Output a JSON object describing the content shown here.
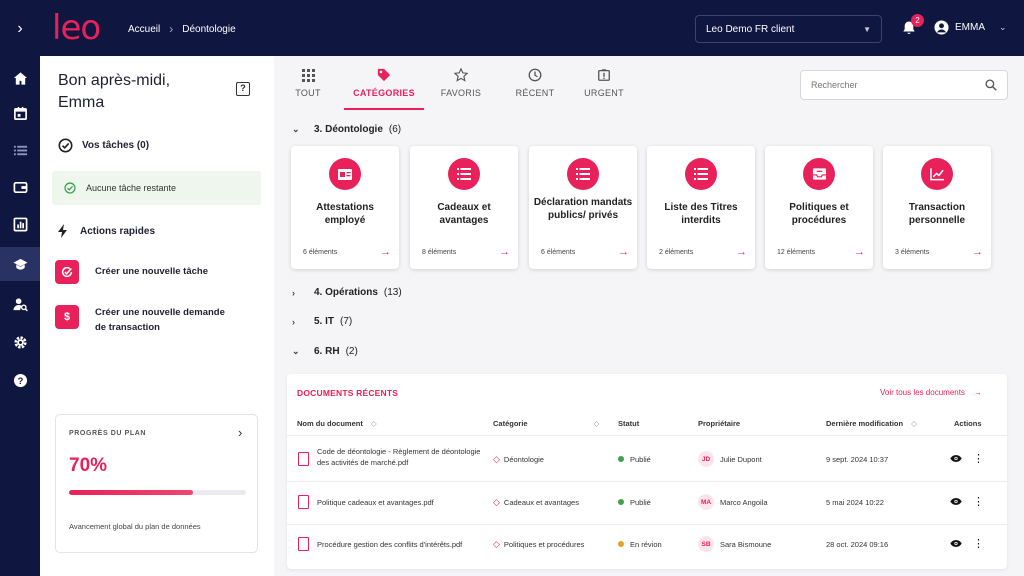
{
  "app": {
    "logo": "leo"
  },
  "breadcrumb": [
    "Accueil",
    "Déontologie"
  ],
  "header": {
    "client": "Leo Demo FR client",
    "notifications": "2",
    "user": "EMMA"
  },
  "colors": {
    "accent": "#e8215a",
    "navy": "#0f1640",
    "success": "#3fa34d",
    "warning": "#e8a21f"
  },
  "sidebar_icons": [
    "chevron-right-icon",
    "home-icon",
    "calendar-icon",
    "list-icon",
    "wallet-icon",
    "report-icon",
    "graduation-cap-icon",
    "user-search-icon",
    "gear-icon",
    "question-icon"
  ],
  "left": {
    "greeting": "Bon après-midi,",
    "name": "Emma",
    "tasks_title": "Vos tâches (0)",
    "no_tasks": "Aucune tâche restante",
    "quick_title": "Actions rapides",
    "actions": [
      "Créer une nouvelle tâche",
      "Créer une nouvelle demande de transaction"
    ],
    "plan": {
      "label": "PROGRÈS DU PLAN",
      "percent_text": "70%",
      "progress": 0.7,
      "desc": "Avancement global du plan de données"
    }
  },
  "tabs": [
    {
      "label": "TOUT",
      "icon": "grid-icon"
    },
    {
      "label": "CATÉGORIES",
      "icon": "tag-icon",
      "active": true
    },
    {
      "label": "FAVORIS",
      "icon": "star-icon"
    },
    {
      "label": "RÉCENT",
      "icon": "clock-icon"
    },
    {
      "label": "URGENT",
      "icon": "urgent-icon"
    }
  ],
  "search": {
    "placeholder": "Rechercher"
  },
  "categories": [
    {
      "label": "3. Déontologie",
      "count": "(6)",
      "expanded": true
    },
    {
      "label": "4. Opérations",
      "count": "(13)"
    },
    {
      "label": "5. IT",
      "count": "(7)"
    },
    {
      "label": "6. RH",
      "count": "(2)",
      "expanded": true
    }
  ],
  "cards": [
    {
      "title": "Attestations employé",
      "count": "6 éléments"
    },
    {
      "title": "Cadeaux et avantages",
      "count": "8 éléments"
    },
    {
      "title": "Déclaration mandats publics/ privés",
      "count": "6 éléments"
    },
    {
      "title": "Liste des Titres interdits",
      "count": "2 éléments"
    },
    {
      "title": "Politiques et procédures",
      "count": "12 éléments"
    },
    {
      "title": "Transaction personnelle",
      "count": "3 éléments"
    }
  ],
  "recent": {
    "title": "DOCUMENTS RÉCENTS",
    "view_all": "Voir tous les documents",
    "columns": [
      "Nom du document",
      "Catégorie",
      "Statut",
      "Propriétaire",
      "Dernière modification",
      "Actions"
    ],
    "rows": [
      {
        "name": "Code de déontologie - Règlement de déontologie des activités de marché.pdf",
        "category": "Déontologie",
        "status": "Publié",
        "status_color": "#3fa34d",
        "initials": "JD",
        "owner": "Julie Dupont",
        "date": "9 sept. 2024 10:37"
      },
      {
        "name": "Politique cadeaux et avantages.pdf",
        "category": "Cadeaux et avantages",
        "status": "Publié",
        "status_color": "#3fa34d",
        "initials": "MA",
        "owner": "Marco Angoila",
        "date": "5 mai 2024 10:22"
      },
      {
        "name": "Procédure gestion des conflits d'intérêts.pdf",
        "category": "Politiques et procédures",
        "status": "En révion",
        "status_color": "#e8a21f",
        "initials": "SB",
        "owner": "Sara Bismoune",
        "date": "28 oct. 2024 09:16"
      }
    ]
  }
}
